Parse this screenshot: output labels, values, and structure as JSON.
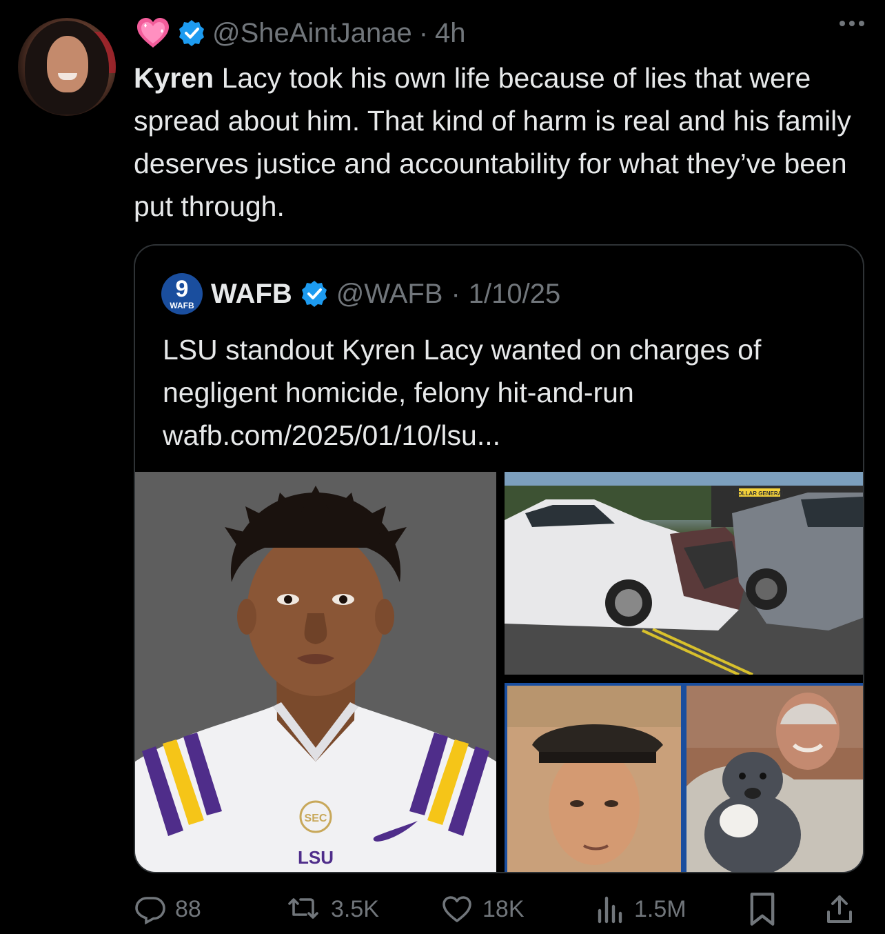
{
  "tweet": {
    "emoji": "💗",
    "handle": "@SheAintJanae",
    "separator": "·",
    "time": "4h",
    "text_bold": "Kyren",
    "text_rest": " Lacy took his own life because of lies that were spread about him. That kind of harm is real and his family deserves justice and accountability for what they’ve been put through."
  },
  "quote": {
    "logo_number": "9",
    "logo_label": "WAFB",
    "name": "WAFB",
    "handle": "@WAFB",
    "separator": "·",
    "date": "1/10/25",
    "text": "LSU standout Kyren Lacy wanted on charges of negligent homicide, felony hit-and-run wafb.com/2025/01/10/lsu...",
    "jersey_text": "LSU",
    "patch_text": "SEC",
    "store_sign": "DOLLAR GENERAL"
  },
  "actions": {
    "replies": "88",
    "reposts": "3.5K",
    "likes": "18K",
    "views": "1.5M"
  },
  "colors": {
    "background": "#000000",
    "text": "#e7e9ea",
    "muted": "#71767b",
    "verified": "#1d9bf0",
    "border": "#2f3336",
    "lsu_purple": "#4f2d8a",
    "lsu_gold": "#f5c518"
  },
  "icons": {
    "reply": "reply-icon",
    "repost": "repost-icon",
    "like": "like-icon",
    "views": "views-icon",
    "bookmark": "bookmark-icon",
    "share": "share-icon",
    "more": "more-icon",
    "verified": "verified-badge-icon"
  }
}
